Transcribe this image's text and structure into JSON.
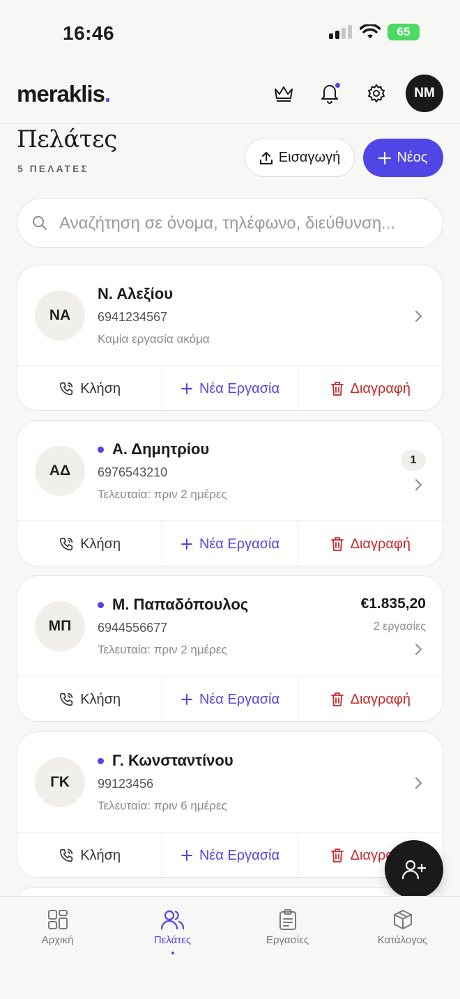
{
  "status_bar": {
    "time": "16:46",
    "battery": "65"
  },
  "header": {
    "logo": "meraklis",
    "logo_dot": ".",
    "avatar_initials": "NM"
  },
  "page": {
    "title": "Πελάτες",
    "subtitle": "5 ΠΕΛΑΤΕΣ",
    "import_label": "Εισαγωγή",
    "new_label": "Νέος"
  },
  "search": {
    "placeholder": "Αναζήτηση σε όνομα, τηλέφωνο, διεύθυνση..."
  },
  "actions": {
    "call": "Κλήση",
    "new_job": "Νέα Εργασία",
    "delete": "Διαγραφή"
  },
  "customers": [
    {
      "initials": "ΝΑ",
      "name": "Ν. Αλεξίου",
      "phone": "6941234567",
      "status": "Καμία εργασία ακόμα",
      "active": false
    },
    {
      "initials": "ΑΔ",
      "name": "Α. Δημητρίου",
      "phone": "6976543210",
      "status": "Τελευταία: πριν 2 ημέρες",
      "active": true,
      "badge": "1"
    },
    {
      "initials": "ΜΠ",
      "name": "Μ. Παπαδόπουλος",
      "phone": "6944556677",
      "status": "Τελευταία: πριν 2 ημέρες",
      "active": true,
      "amount": "€1.835,20",
      "jobs": "2 εργασίες"
    },
    {
      "initials": "ΓΚ",
      "name": "Γ. Κωνσταντίνου",
      "phone": "99123456",
      "status": "Τελευταία: πριν 6 ημέρες",
      "active": true
    }
  ],
  "nav": [
    {
      "label": "Αρχική",
      "icon": "grid-icon"
    },
    {
      "label": "Πελάτες",
      "icon": "users-icon",
      "active": true
    },
    {
      "label": "Εργασίες",
      "icon": "clipboard-icon"
    },
    {
      "label": "Κατάλογος",
      "icon": "box-icon"
    }
  ],
  "colors": {
    "accent": "#5046e5",
    "danger": "#c62828",
    "dark": "#1a1a1a"
  }
}
